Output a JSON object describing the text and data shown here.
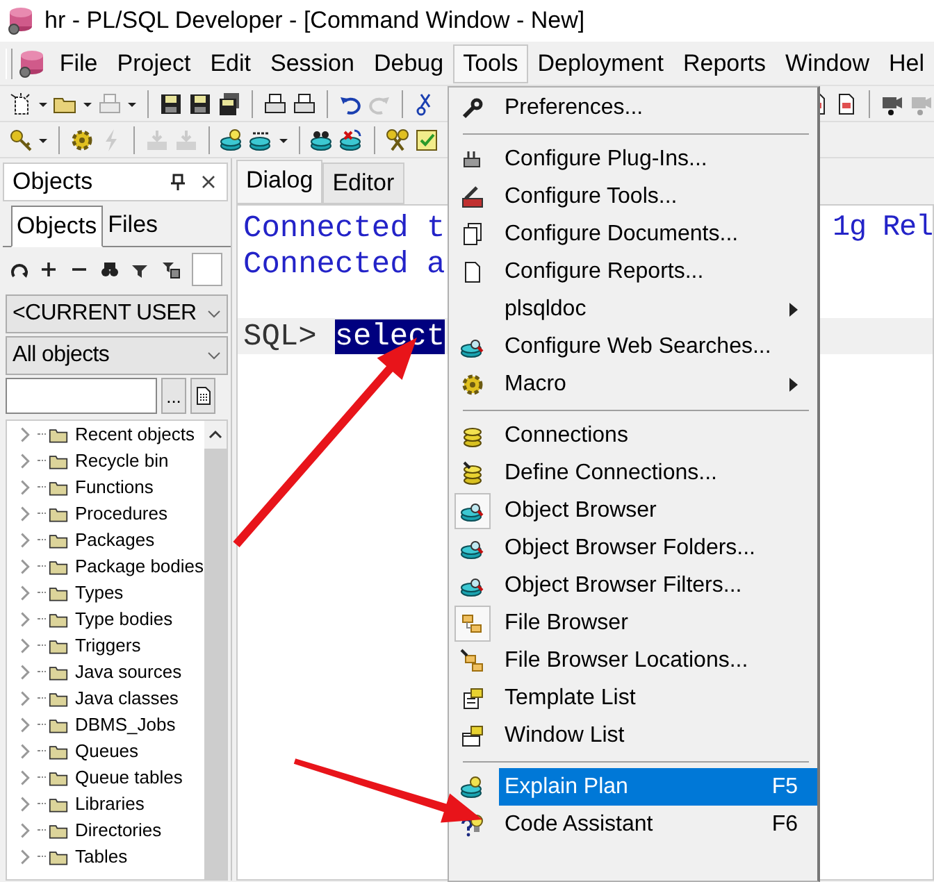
{
  "window": {
    "title": "hr - PL/SQL Developer - [Command Window - New]"
  },
  "menu_bar": [
    {
      "label": "File",
      "selected": false
    },
    {
      "label": "Project",
      "selected": false
    },
    {
      "label": "Edit",
      "selected": false
    },
    {
      "label": "Session",
      "selected": false
    },
    {
      "label": "Debug",
      "selected": false
    },
    {
      "label": "Tools",
      "selected": true
    },
    {
      "label": "Deployment",
      "selected": false
    },
    {
      "label": "Reports",
      "selected": false
    },
    {
      "label": "Window",
      "selected": false
    },
    {
      "label": "Hel",
      "selected": false
    }
  ],
  "objects_panel": {
    "title": "Objects",
    "tabs": [
      {
        "label": "Objects",
        "selected": true
      },
      {
        "label": "Files",
        "selected": false
      }
    ],
    "owner_dropdown": {
      "value": "<CURRENT USER"
    },
    "filter_dropdown": {
      "value": "All objects"
    },
    "more_button": "...",
    "tree": [
      {
        "label": "Recent objects"
      },
      {
        "label": "Recycle bin"
      },
      {
        "label": "Functions"
      },
      {
        "label": "Procedures"
      },
      {
        "label": "Packages"
      },
      {
        "label": "Package bodies"
      },
      {
        "label": "Types"
      },
      {
        "label": "Type bodies"
      },
      {
        "label": "Triggers"
      },
      {
        "label": "Java sources"
      },
      {
        "label": "Java classes"
      },
      {
        "label": "DBMS_Jobs"
      },
      {
        "label": "Queues"
      },
      {
        "label": "Queue tables"
      },
      {
        "label": "Libraries"
      },
      {
        "label": "Directories"
      },
      {
        "label": "Tables"
      }
    ]
  },
  "editor": {
    "tabs": [
      {
        "label": "Dialog",
        "selected": true
      },
      {
        "label": "Editor",
        "selected": false
      }
    ],
    "lines": [
      {
        "kind": "output",
        "text": "Connected t",
        "tail": "1g Rel"
      },
      {
        "kind": "output",
        "text": "Connected a"
      },
      {
        "kind": "blank"
      },
      {
        "kind": "prompt",
        "prompt": "SQL>",
        "selection": "select"
      }
    ]
  },
  "tools_menu": {
    "items": [
      {
        "kind": "item",
        "label": "Preferences...",
        "submenu": false,
        "checked": false,
        "selected": false
      },
      {
        "kind": "separator"
      },
      {
        "kind": "item",
        "label": "Configure Plug-Ins...",
        "submenu": false,
        "checked": false,
        "selected": false
      },
      {
        "kind": "item",
        "label": "Configure Tools...",
        "submenu": false,
        "checked": false,
        "selected": false
      },
      {
        "kind": "item",
        "label": "Configure Documents...",
        "submenu": false,
        "checked": false,
        "selected": false
      },
      {
        "kind": "item",
        "label": "Configure Reports...",
        "submenu": false,
        "checked": false,
        "selected": false
      },
      {
        "kind": "item",
        "label": "plsqldoc",
        "submenu": true,
        "checked": false,
        "selected": false
      },
      {
        "kind": "item",
        "label": "Configure Web Searches...",
        "submenu": false,
        "checked": false,
        "selected": false
      },
      {
        "kind": "item",
        "label": "Macro",
        "submenu": true,
        "checked": false,
        "selected": false
      },
      {
        "kind": "separator"
      },
      {
        "kind": "item",
        "label": "Connections",
        "submenu": false,
        "checked": false,
        "selected": false
      },
      {
        "kind": "item",
        "label": "Define Connections...",
        "submenu": false,
        "checked": false,
        "selected": false
      },
      {
        "kind": "item",
        "label": "Object Browser",
        "submenu": false,
        "checked": true,
        "selected": false
      },
      {
        "kind": "item",
        "label": "Object Browser Folders...",
        "submenu": false,
        "checked": false,
        "selected": false
      },
      {
        "kind": "item",
        "label": "Object Browser Filters...",
        "submenu": false,
        "checked": false,
        "selected": false
      },
      {
        "kind": "item",
        "label": "File Browser",
        "submenu": false,
        "checked": true,
        "selected": false
      },
      {
        "kind": "item",
        "label": "File Browser Locations...",
        "submenu": false,
        "checked": false,
        "selected": false
      },
      {
        "kind": "item",
        "label": "Template List",
        "submenu": false,
        "checked": false,
        "selected": false
      },
      {
        "kind": "item",
        "label": "Window List",
        "submenu": false,
        "checked": false,
        "selected": false
      },
      {
        "kind": "separator"
      },
      {
        "kind": "item",
        "label": "Explain Plan",
        "shortcut": "F5",
        "submenu": false,
        "checked": false,
        "selected": true
      },
      {
        "kind": "item",
        "label": "Code Assistant",
        "shortcut": "F6",
        "submenu": false,
        "checked": false,
        "selected": false
      }
    ]
  }
}
